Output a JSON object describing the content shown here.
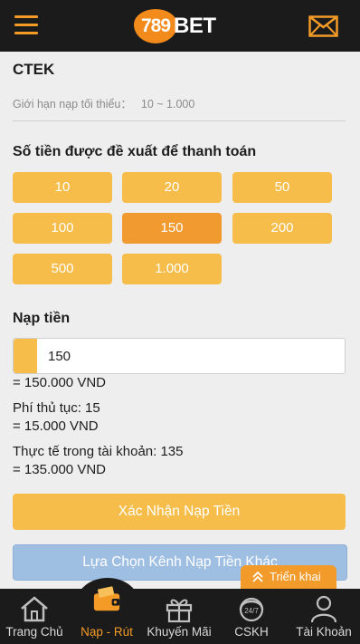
{
  "header": {
    "logo_number": "789",
    "logo_word": "BET"
  },
  "method": {
    "name": "CTEK",
    "limit_label": "Giới hạn nạp tối thiểu：",
    "limit_value": "10 ~ 1.000"
  },
  "suggest": {
    "title": "Số tiền được đề xuất để thanh toán",
    "amounts": [
      "10",
      "20",
      "50",
      "100",
      "150",
      "200",
      "500",
      "1.000"
    ],
    "selected": "150"
  },
  "deposit": {
    "title": "Nạp tiền",
    "input_value": "150",
    "converted": "= 150.000 VND",
    "fee_label": "Phí thủ tục: 15",
    "fee_converted": "= 15.000 VND",
    "actual_label": "Thực tế trong tài khoản: 135",
    "actual_converted": "= 135.000 VND"
  },
  "buttons": {
    "confirm": "Xác Nhận Nạp Tiền",
    "other_channel": "Lựa Chọn Kênh Nạp Tiền Khác",
    "expand": "Triển khai"
  },
  "nav": {
    "items": [
      {
        "label": "Trang Chủ",
        "icon": "home-icon"
      },
      {
        "label": "Nạp - Rút",
        "icon": "wallet-icon"
      },
      {
        "label": "Khuyến Mãi",
        "icon": "gift-icon"
      },
      {
        "label": "CSKH",
        "icon": "support-24-7-icon"
      },
      {
        "label": "Tài Khoản",
        "icon": "user-icon"
      }
    ],
    "active": "Nạp - Rút"
  },
  "colors": {
    "accent": "#f39a27",
    "button_yellow": "#f6bd4a",
    "selected": "#f19a30",
    "bar": "#1b1b1b",
    "secondary_button": "#9fbfe2"
  }
}
